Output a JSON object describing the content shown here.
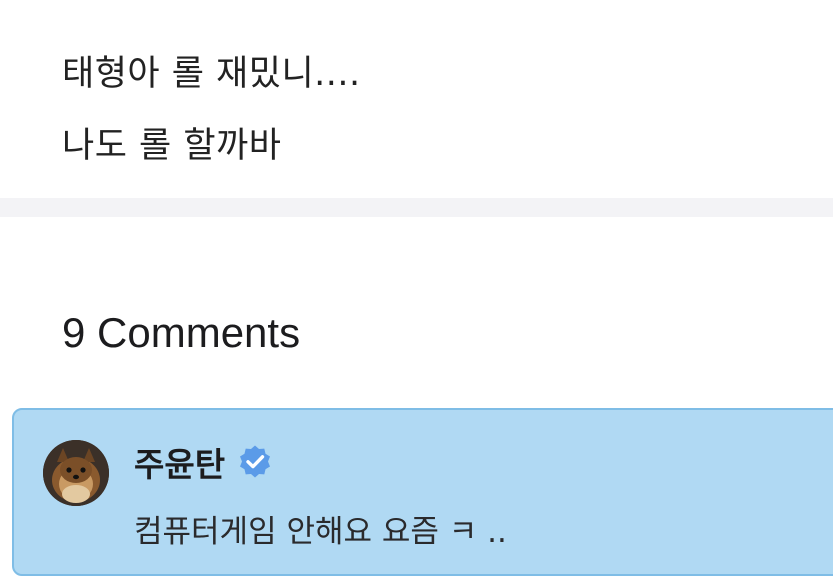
{
  "post": {
    "lines": [
      "태형아 롤 재밌니....",
      "나도 롤 할까바"
    ]
  },
  "comments": {
    "heading": "9 Comments",
    "items": [
      {
        "author": "주윤탄",
        "verified": true,
        "text": "컴퓨터게임 안해요 요즘 ㅋ ..",
        "highlighted": true
      }
    ]
  },
  "colors": {
    "highlight_background": "#b0d9f3",
    "highlight_border": "#7fbde6",
    "verified_badge": "#5b9be8",
    "divider": "#f3f3f6"
  },
  "icons": {
    "verified": "verified-check-badge-icon",
    "avatar": "user-avatar-photo"
  }
}
